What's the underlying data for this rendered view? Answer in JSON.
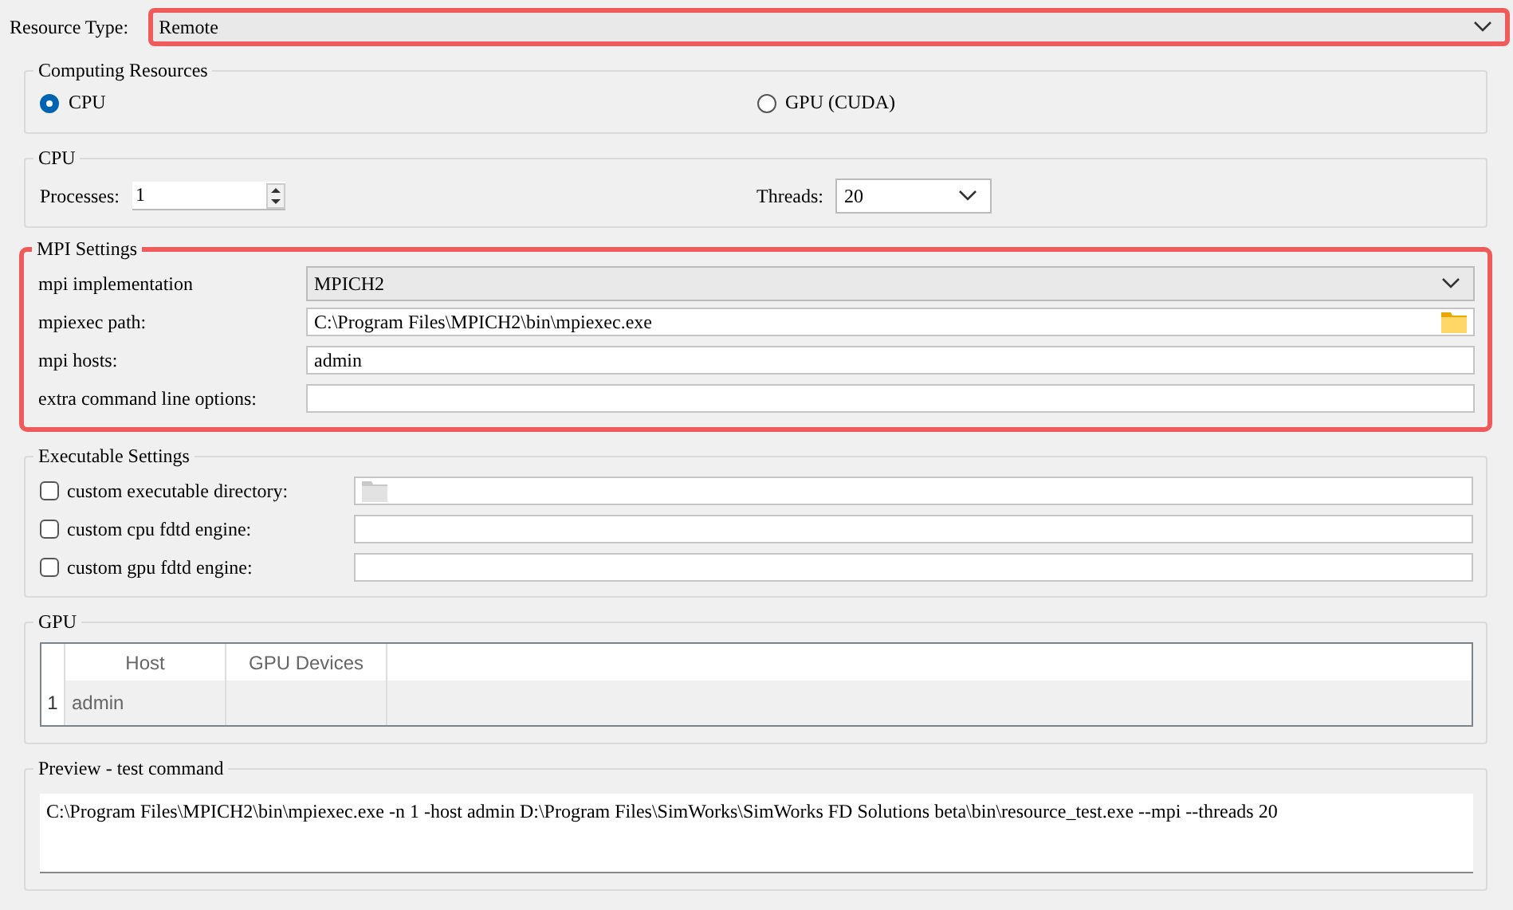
{
  "resource_type": {
    "label": "Resource Type:",
    "value": "Remote",
    "highlighted": true
  },
  "computing_resources": {
    "title": "Computing Resources",
    "options": [
      {
        "label": "CPU",
        "selected": true
      },
      {
        "label": "GPU (CUDA)",
        "selected": false
      }
    ]
  },
  "cpu": {
    "title": "CPU",
    "processes": {
      "label": "Processes:",
      "value": "1"
    },
    "threads": {
      "label": "Threads:",
      "value": "20"
    }
  },
  "mpi_settings": {
    "title": "MPI Settings",
    "highlighted": true,
    "rows": [
      {
        "kind": "dropdown",
        "label": "mpi implementation",
        "value": "MPICH2"
      },
      {
        "kind": "path",
        "label": "mpiexec path:",
        "value": "C:\\Program Files\\MPICH2\\bin\\mpiexec.exe"
      },
      {
        "kind": "text",
        "label": "mpi hosts:",
        "value": "admin"
      },
      {
        "kind": "text",
        "label": "extra command line options:"
      }
    ]
  },
  "executable_settings": {
    "title": "Executable Settings",
    "rows": [
      {
        "kind": "path",
        "label": "custom executable directory:",
        "checked": false
      },
      {
        "kind": "text",
        "label": "custom cpu fdtd engine:",
        "checked": false
      },
      {
        "kind": "text",
        "label": "custom gpu fdtd engine:",
        "checked": false
      }
    ]
  },
  "gpu": {
    "title": "GPU",
    "table": {
      "columns": [
        "Host",
        "GPU Devices"
      ],
      "rows": [
        {
          "number": "1",
          "cells": [
            "admin"
          ]
        }
      ]
    }
  },
  "preview": {
    "title": "Preview - test command",
    "text": "C:\\Program Files\\MPICH2\\bin\\mpiexec.exe -n 1 -host admin D:\\Program Files\\SimWorks\\SimWorks FD Solutions beta\\bin\\resource_test.exe --mpi --threads 20"
  }
}
